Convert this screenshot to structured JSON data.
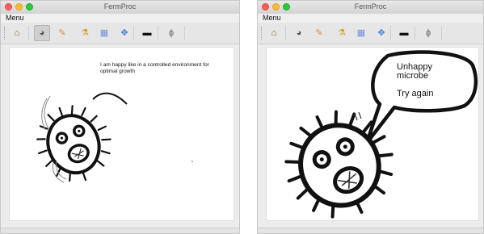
{
  "left_window": {
    "title": "FermProc",
    "menu_label": "Menu",
    "toolbar_icons": [
      "home-icon",
      "microbe-icon",
      "pencil-icon",
      "flask-icon",
      "grid-icon",
      "puzzle-icon",
      "battery-icon",
      "probe-icon"
    ],
    "active_tool": "microbe-icon",
    "message": "I am happy like in a controlled environment for optimal growth"
  },
  "right_window": {
    "title": "FermProc",
    "menu_label": "Menu",
    "toolbar_icons": [
      "home-icon",
      "microbe-icon",
      "pencil-icon",
      "flask-icon",
      "grid-icon",
      "puzzle-icon",
      "battery-icon",
      "probe-icon"
    ],
    "bubble_line1": "Unhappy microbe",
    "bubble_line2": "Try again"
  },
  "colors": {
    "close": "#ff5f57",
    "minimize": "#febc2e",
    "maximize": "#28c840"
  }
}
